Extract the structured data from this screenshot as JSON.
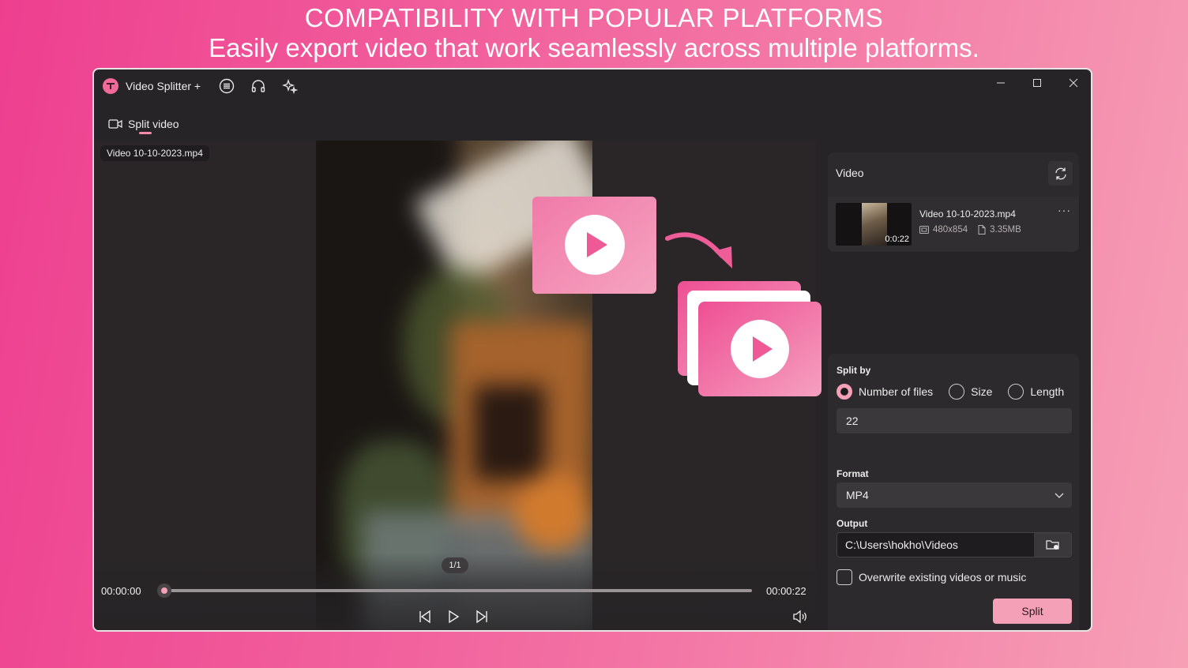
{
  "headline": {
    "title": "COMPATIBILITY WITH POPULAR PLATFORMS",
    "subtitle": "Easily export video that work seamlessly across multiple platforms."
  },
  "app": {
    "title": "Video Splitter +",
    "icons": [
      "menu-icon",
      "headphones-icon",
      "sparkle-icon"
    ],
    "window_controls": [
      "minimize-icon",
      "maximize-icon",
      "close-icon"
    ]
  },
  "tab": {
    "label": "Split video",
    "icon": "video-camera-icon"
  },
  "player": {
    "file_name": "Video 10-10-2023.mp4",
    "page_indicator": "1/1",
    "time_current": "00:00:00",
    "time_total": "00:00:22",
    "progress": 0.0
  },
  "video_panel": {
    "title": "Video",
    "item": {
      "name": "Video 10-10-2023.mp4",
      "duration": "0:0:22",
      "resolution": "480x854",
      "size": "3.35MB",
      "more": "···"
    }
  },
  "settings": {
    "split_by_label": "Split by",
    "options": [
      "Number of files",
      "Size",
      "Length"
    ],
    "selected_option": "Number of files",
    "value": "22",
    "format_label": "Format",
    "format_value": "MP4",
    "output_label": "Output",
    "output_path": "C:\\Users\\hokho\\Videos",
    "overwrite_label": "Overwrite existing videos or music",
    "overwrite_checked": false,
    "split_button": "Split"
  },
  "colors": {
    "accent": "#f4a0b6",
    "brand_pink": "#ee3f8f",
    "window_bg": "#262426"
  }
}
